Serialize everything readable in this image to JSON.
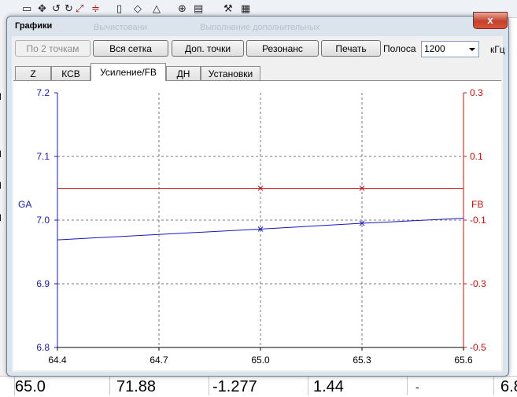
{
  "background": {
    "cells": [
      "65.0",
      "71.88",
      "-1.277",
      "1.44",
      "-",
      "6.8"
    ]
  },
  "dialog": {
    "title": "Графики",
    "title_ghost": [
      "Вычистовани",
      "Выполнение дополнительных"
    ],
    "close_label": "x"
  },
  "toolbar": {
    "btn_two_points": "По 2 точкам",
    "btn_full_grid": "Вся сетка",
    "btn_extra_points": "Доп. точки",
    "btn_resonance": "Резонанс",
    "btn_print": "Печать",
    "band_label": "Полоса",
    "band_value": "1200",
    "band_unit": "кГц"
  },
  "tabs": [
    "Z",
    "КСВ",
    "Усиление/FB",
    "ДН",
    "Установки"
  ],
  "active_tab": "Усиление/FB",
  "colors": {
    "ga": "#1515c8",
    "fb": "#c81515",
    "grid": "#777777",
    "axis": "#000000"
  },
  "chart_data": {
    "type": "line",
    "x": [
      64.4,
      65.0,
      65.3,
      65.6
    ],
    "xlim": [
      64.4,
      65.6
    ],
    "xticks": [
      "64.4",
      "64.7",
      "65.0",
      "65.3",
      "65.6"
    ],
    "xtick_values": [
      64.4,
      64.7,
      65.0,
      65.3,
      65.6
    ],
    "y_left": {
      "label": "GA",
      "lim": [
        6.8,
        7.2
      ],
      "ticks": [
        "7.2",
        "7.1",
        "7.0",
        "6.9",
        "6.8"
      ],
      "tick_values": [
        7.2,
        7.1,
        7.0,
        6.9,
        6.8
      ]
    },
    "y_right": {
      "label": "FB",
      "lim": [
        -0.5,
        0.3
      ],
      "ticks": [
        "0.3",
        "0.1",
        "-0.1",
        "-0.3",
        "-0.5"
      ],
      "tick_values": [
        0.3,
        0.1,
        -0.1,
        -0.3,
        -0.5
      ]
    },
    "grid": true,
    "series": [
      {
        "name": "GA",
        "axis": "left",
        "color": "#1515c8",
        "values": [
          6.969,
          6.986,
          6.995,
          7.003
        ],
        "markers_at": [
          65.0,
          65.3
        ]
      },
      {
        "name": "FB",
        "axis": "right",
        "color": "#c81515",
        "values": [
          0.0,
          0.0,
          0.0,
          0.0
        ],
        "markers_at": [
          65.0,
          65.3
        ]
      }
    ]
  }
}
